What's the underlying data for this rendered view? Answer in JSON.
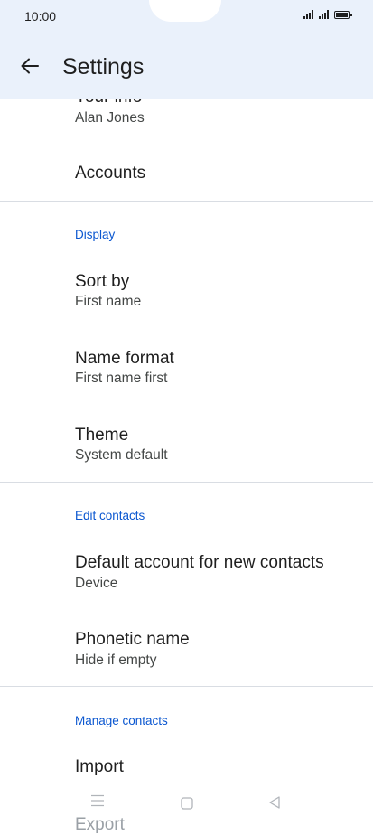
{
  "status_bar": {
    "time": "10:00"
  },
  "header": {
    "title": "Settings"
  },
  "items": {
    "your_info": {
      "title": "Your info",
      "subtitle": "Alan Jones"
    },
    "accounts": {
      "title": "Accounts"
    },
    "sort_by": {
      "title": "Sort by",
      "subtitle": "First name"
    },
    "name_format": {
      "title": "Name format",
      "subtitle": "First name first"
    },
    "theme": {
      "title": "Theme",
      "subtitle": "System default"
    },
    "default_account": {
      "title": "Default account for new contacts",
      "subtitle": "Device"
    },
    "phonetic_name": {
      "title": "Phonetic name",
      "subtitle": "Hide if empty"
    },
    "import": {
      "title": "Import"
    },
    "export": {
      "title": "Export"
    }
  },
  "sections": {
    "display": "Display",
    "edit_contacts": "Edit contacts",
    "manage_contacts": "Manage contacts"
  },
  "colors": {
    "accent": "#0b57d0",
    "header_bg": "#eaf1fb"
  }
}
